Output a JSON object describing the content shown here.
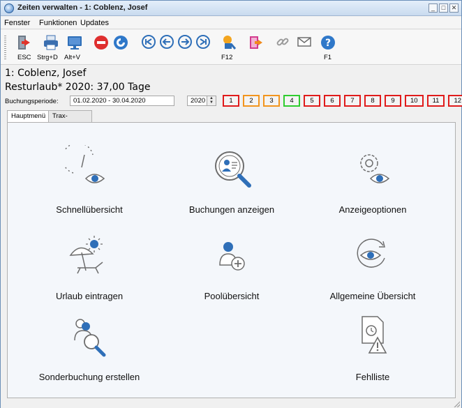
{
  "window": {
    "title": "Zeiten verwalten - 1: Coblenz, Josef"
  },
  "menu": [
    "Fenster",
    "Funktionen",
    "Updates"
  ],
  "toolbar": {
    "esc_label": "ESC",
    "print_label": "Strg+D",
    "screen_label": "Alt+V",
    "f12_label": "F12",
    "f1_label": "F1"
  },
  "employee": {
    "name": "1: Coblenz, Josef",
    "vacation": "Resturlaub* 2020: 37,00 Tage"
  },
  "period": {
    "label": "Buchungsperiode:",
    "value": "01.02.2020 - 30.04.2020",
    "year": "2020",
    "months": [
      {
        "label": "1",
        "status": "red"
      },
      {
        "label": "2",
        "status": "orange"
      },
      {
        "label": "3",
        "status": "orange"
      },
      {
        "label": "4",
        "status": "green"
      },
      {
        "label": "5",
        "status": "red"
      },
      {
        "label": "6",
        "status": "red"
      },
      {
        "label": "7",
        "status": "red"
      },
      {
        "label": "8",
        "status": "red"
      },
      {
        "label": "9",
        "status": "red"
      },
      {
        "label": "10",
        "status": "red"
      },
      {
        "label": "11",
        "status": "red"
      },
      {
        "label": "12",
        "status": "red"
      }
    ]
  },
  "tabs": [
    "Hauptmenü",
    "Trax-Stempelung"
  ],
  "tiles": {
    "schnell": "Schnellübersicht",
    "buchungen": "Buchungen anzeigen",
    "anzeige": "Anzeigeoptionen",
    "urlaub": "Urlaub eintragen",
    "pool": "Poolübersicht",
    "allgemein": "Allgemeine Übersicht",
    "sonder": "Sonderbuchung erstellen",
    "fehl": "Fehlliste"
  },
  "colors": {
    "month_red": "#e01b1b",
    "month_orange": "#f2951e",
    "month_green": "#2fcc2f",
    "icon_blue": "#2f6fb8"
  }
}
